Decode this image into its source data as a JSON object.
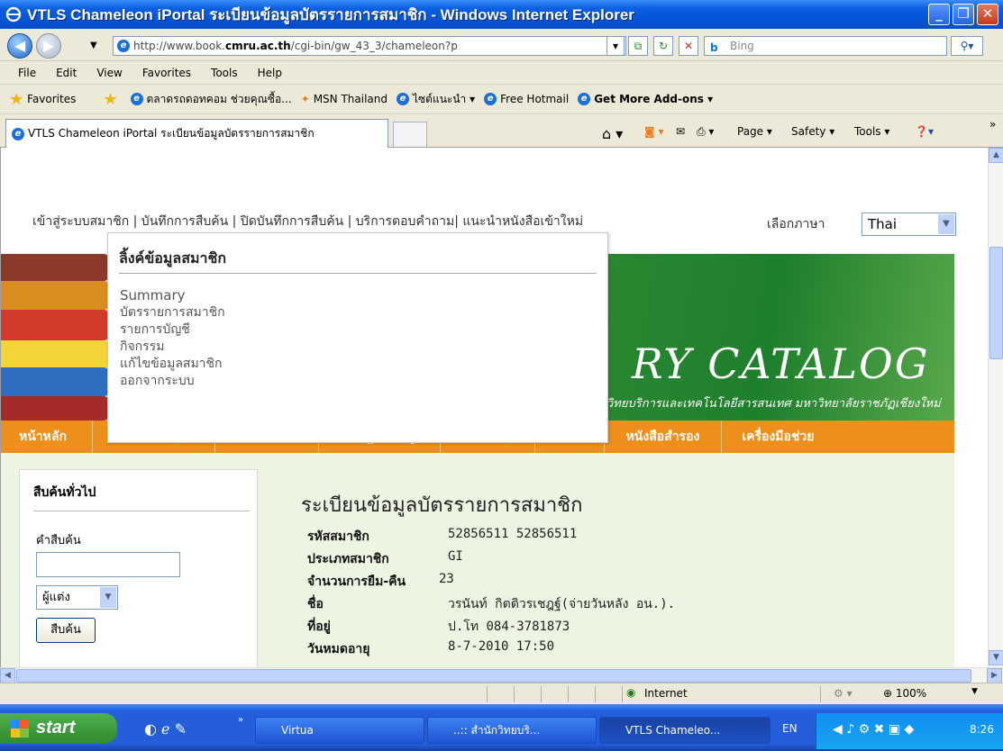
{
  "window": {
    "title": "VTLS Chameleon iPortal ระเบียนข้อมูลบัตรรายการสมาชิก - Windows Internet Explorer"
  },
  "address": {
    "url_pre": "http://www.book.",
    "url_domain": "cmru.ac.th",
    "url_post": "/cgi-bin/gw_43_3/chameleon?p",
    "search_placeholder": "Bing"
  },
  "menu": [
    "File",
    "Edit",
    "View",
    "Favorites",
    "Tools",
    "Help"
  ],
  "favorites": {
    "label": "Favorites",
    "items": [
      "ตลาดรถดอทคอม ช่วยคุณซื้อ...",
      "MSN Thailand",
      "ไซต์แนะนำ ▾",
      "Free Hotmail",
      "Get More Add-ons ▾"
    ]
  },
  "tab": {
    "label": "VTLS Chameleon iPortal ระเบียนข้อมูลบัตรรายการสมาชิก"
  },
  "commands": {
    "page": "Page ▾",
    "safety": "Safety ▾",
    "tools": "Tools ▾"
  },
  "page": {
    "topnav": "เข้าสู่ระบบสมาชิก | บันทึกการสืบค้น | ปิดบันทึกการสืบค้น | บริการตอบคำถาม| แนะนำหนังสือเข้าใหม่",
    "lang_label": "เลือกภาษา",
    "lang_value": "Thai",
    "banner_text": "RY CATALOG",
    "banner_sub": "สำนักวิทยบริการและเทคโนโลยีสารสนเทศ มหาวิทยาลัยราชภัฏเชียงใหม่",
    "nav": [
      "หน้าหลัก",
      "คำสำคัญ",
      "รายการหลัก",
      "หลายฐานข้อมูล",
      "เชี่ยวชาญ",
      "จัดเก็บ",
      "หนังสือสำรอง",
      "เครื่องมือช่วย"
    ],
    "sidebar": {
      "title": "สืบค้นทั่วไป",
      "label": "คำสืบค้น",
      "select": "ผู้แต่ง",
      "button": "สืบค้น"
    },
    "main_title": "ระเบียนข้อมูลบัตรรายการสมาชิก",
    "info": [
      {
        "k": "รหัสสมาชิก",
        "v": "52856511 52856511"
      },
      {
        "k": "ประเภทสมาชิก",
        "v": "GI"
      },
      {
        "k": "จำนวนการยืม-คืน",
        "v": "23"
      },
      {
        "k": "ชื่อ",
        "v": "วรนันท์ กิตติวรเชฎฐ์(จ่ายวันหลัง อน.)."
      },
      {
        "k": "ที่อยู่",
        "v": "ป.โท 084-3781873"
      },
      {
        "k": "วันหมดอายุ",
        "v": "8-7-2010 17:50"
      }
    ],
    "popup": {
      "title": "ลิ้งค์ข้อมูลสมาชิก",
      "links": [
        "Summary",
        "บัตรรายการสมาชิก",
        "รายการบัญชี",
        "กิจกรรม",
        "แก้ไขข้อมูลสมาชิก",
        "ออกจากระบบ"
      ]
    }
  },
  "status": {
    "zone": "Internet",
    "zoom": "100%"
  },
  "taskbar": {
    "start": "start",
    "items": [
      "Virtua",
      "..:: สำนักวิทยบริ...",
      "VTLS Chameleo..."
    ],
    "lang": "EN",
    "clock": "8:26"
  }
}
